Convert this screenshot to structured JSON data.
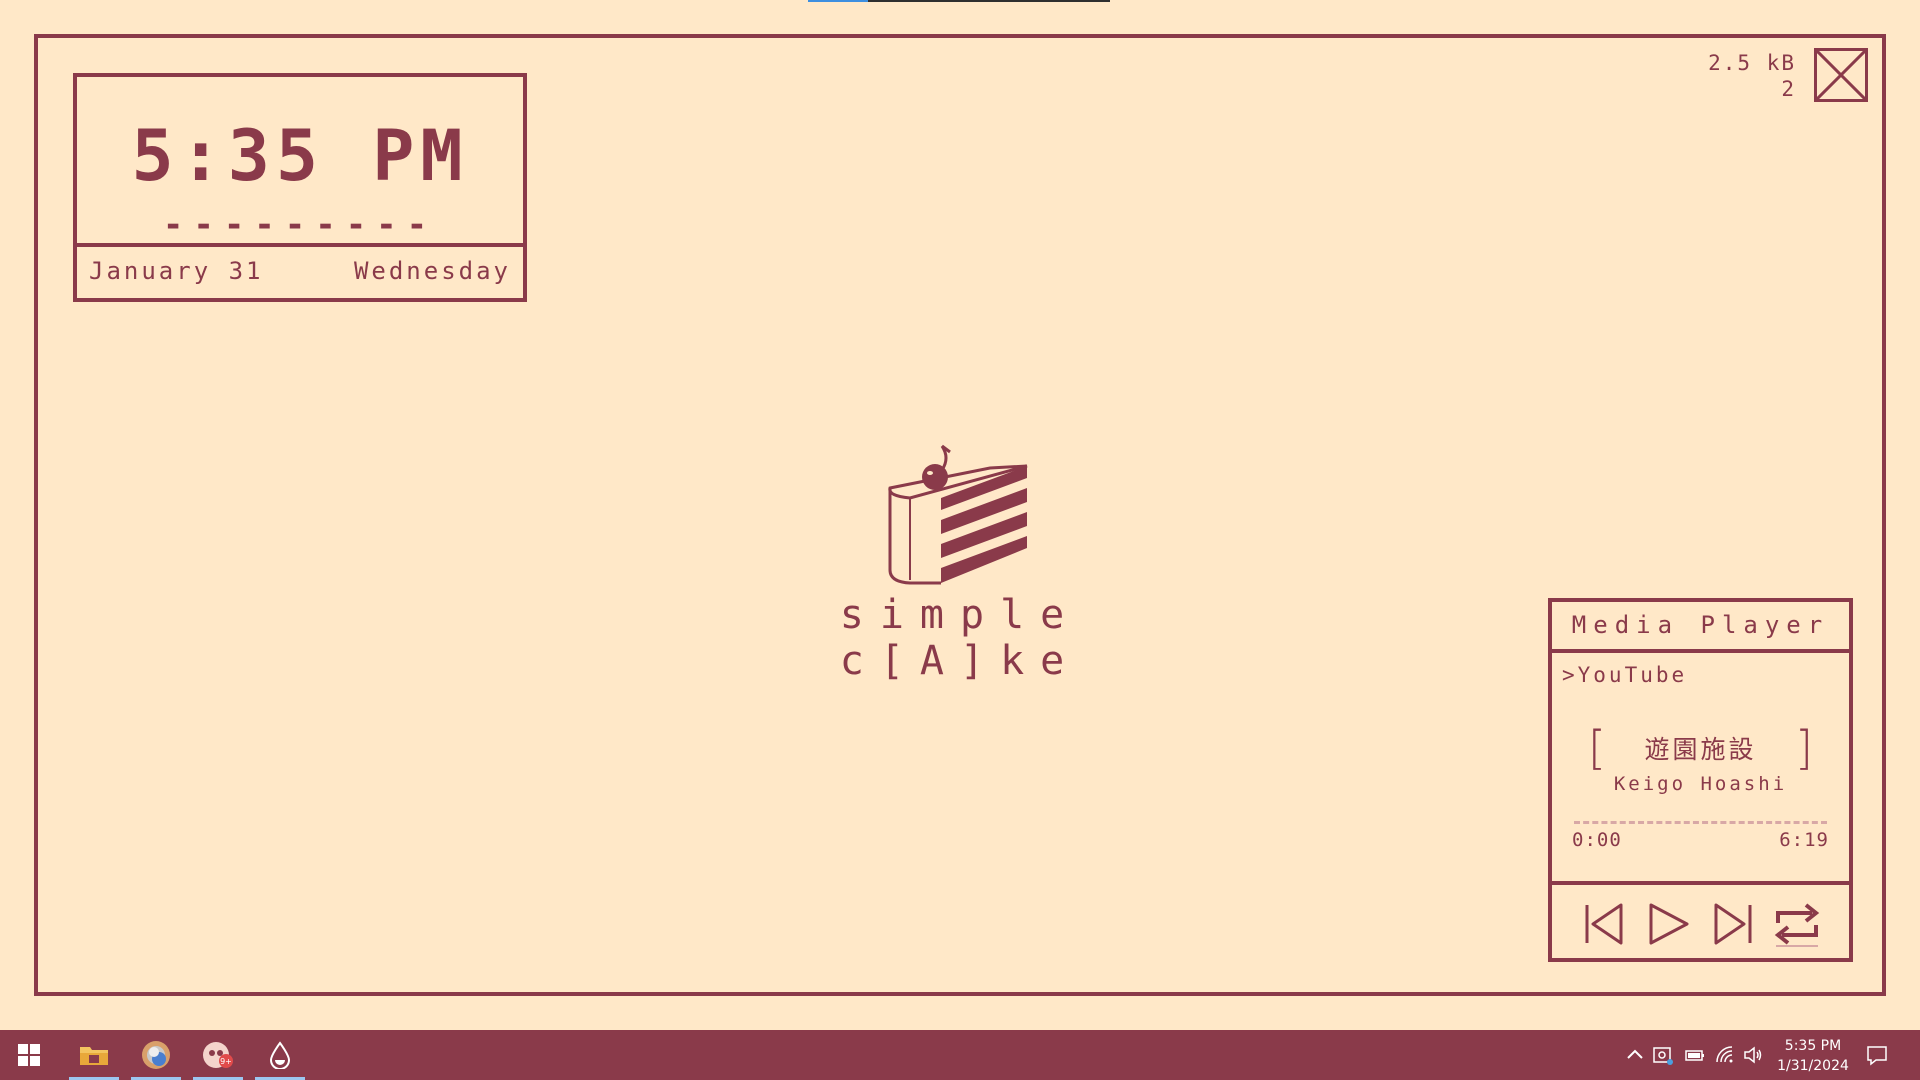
{
  "clock": {
    "time": "5:35 PM",
    "dashes": "---------",
    "date": "January 31",
    "weekday": "Wednesday"
  },
  "stats": {
    "size": "2.5 kB",
    "count": "2"
  },
  "brand": {
    "title": "simple c[A]ke"
  },
  "media": {
    "header": "Media Player",
    "source": ">YouTube",
    "bracket_open": "[",
    "bracket_close": "]",
    "title": "遊園施設",
    "artist": "Keigo Hoashi",
    "elapsed": "0:00",
    "duration": "6:19",
    "progress": 0
  },
  "taskbar": {
    "time": "5:35 PM",
    "date": "1/31/2024",
    "apps": [
      "file-explorer-icon",
      "chrome-icon",
      "game-app-icon",
      "drop-app-icon"
    ],
    "notification_badge": "9+"
  },
  "colors": {
    "background": "#ffe8c8",
    "accent": "#8a3a4a",
    "taskbar_underline": "#9cc6ef"
  }
}
